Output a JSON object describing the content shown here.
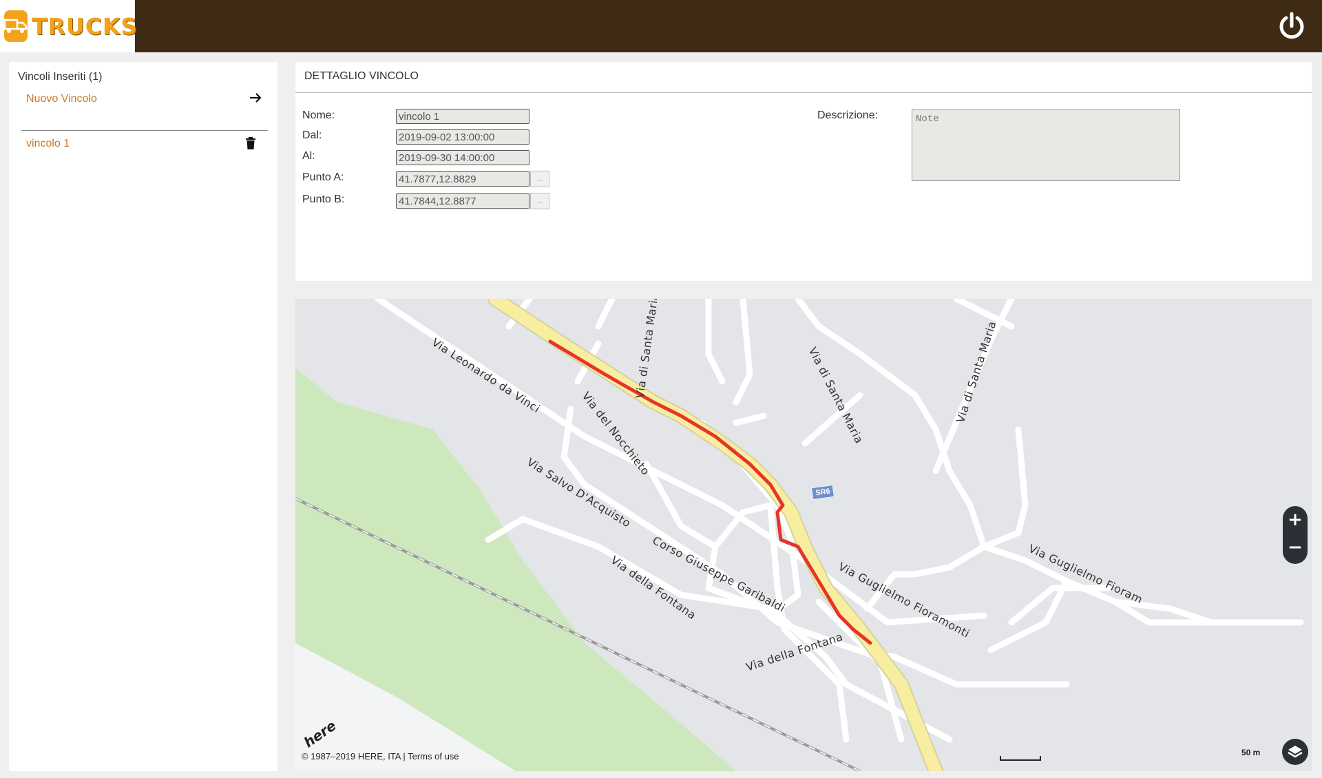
{
  "header": {
    "logo_text": "TRUCKS",
    "logo_icon": "truck-icon",
    "power_icon": "power-icon"
  },
  "sidebar": {
    "title": "Vincoli Inseriti (1)",
    "new_item_label": "Nuovo Vincolo",
    "new_item_icon": "arrow-right-icon",
    "items": [
      {
        "label": "vincolo 1",
        "icon": "trash-icon"
      }
    ]
  },
  "detail": {
    "title": "DETTAGLIO VINCOLO",
    "fields": {
      "nome": {
        "label": "Nome:",
        "value": "vincolo 1"
      },
      "dal": {
        "label": "Dal:",
        "value": "2019-09-02 13:00:00"
      },
      "al": {
        "label": "Al:",
        "value": "2019-09-30 14:00:00"
      },
      "punto_a": {
        "label": "Punto A:",
        "value": "41.7877,12.8829",
        "button": ".."
      },
      "punto_b": {
        "label": "Punto B:",
        "value": "41.7844,12.8877",
        "button": ".."
      },
      "descrizione": {
        "label": "Descrizione:",
        "placeholder": "Note"
      }
    }
  },
  "map": {
    "roads": {
      "leonardo": "Via Leonardo da Vinci",
      "nocchieto": "Via del Nocchieto",
      "santa_maria_1": "Via di Santa Maria",
      "santa_maria_2": "Via di Santa Maria",
      "santa_maria_3": "Via di Santa Maria",
      "salvo": "Via Salvo D'Acquisto",
      "garibaldi": "Corso Giuseppe Garibaldi",
      "fontana_1": "Via della Fontana",
      "fontana_2": "Via della Fontana",
      "fioramonti_1": "Via Guglielmo Fioramonti",
      "fioramonti_2": "Via Guglielmo Fioram"
    },
    "route_badge": "SR6",
    "zoom_in": "+",
    "zoom_out": "−",
    "scale_label": "50 m",
    "copyright": "© 1987–2019 HERE, ITA | ",
    "terms": "Terms of use",
    "provider_logo": "here",
    "colors": {
      "route": "#e8332a",
      "main_road": "#f7eea0",
      "park": "#cde8bc",
      "background": "#e3e5e8"
    }
  }
}
